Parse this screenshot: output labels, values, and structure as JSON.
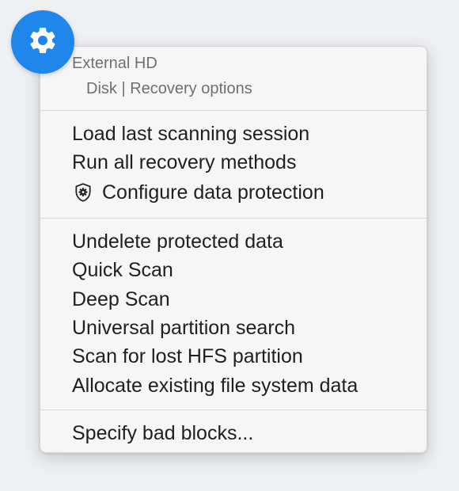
{
  "menu": {
    "title": "External HD",
    "subtitle": "Disk | Recovery options",
    "groups": [
      {
        "items": [
          {
            "label": "Load last scanning session"
          },
          {
            "label": "Run all recovery methods"
          },
          {
            "label": "Configure data protection",
            "icon": "shield-gear-icon"
          }
        ]
      },
      {
        "items": [
          {
            "label": "Undelete protected data"
          },
          {
            "label": "Quick Scan"
          },
          {
            "label": "Deep Scan"
          },
          {
            "label": "Universal partition search"
          },
          {
            "label": "Scan for lost HFS partition"
          },
          {
            "label": "Allocate existing file system data"
          }
        ]
      },
      {
        "items": [
          {
            "label": "Specify bad blocks..."
          }
        ]
      }
    ]
  },
  "gear_button": {
    "icon": "gear-icon",
    "color": "#1f86ec"
  }
}
